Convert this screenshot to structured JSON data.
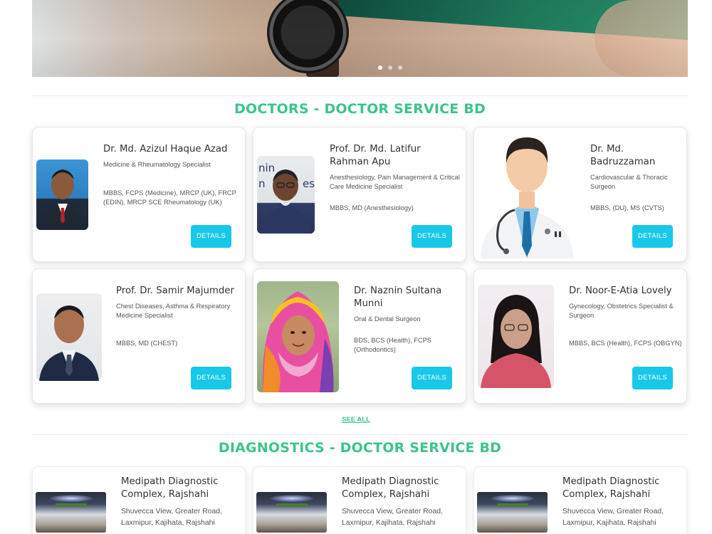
{
  "carousel": {
    "slide_count": 3,
    "active_index": 0
  },
  "doctors_section": {
    "title": "DOCTORS - DOCTOR SERVICE BD",
    "see_all_label": "SEE ALL"
  },
  "doctors": [
    {
      "name": "Dr. Md. Azizul Haque Azad",
      "specialty": "Medicine & Rheumatology Specialist",
      "degrees": "MBBS, FCPS (Medicine), MRCP (UK), FRCP (EDIN), MRCP SCE Rheumatology (UK)",
      "details_label": "DETAILS"
    },
    {
      "name": "Prof. Dr. Md. Latifur Rahman Apu",
      "specialty": "Anesthesiology, Pain Management & Critical Care Medicine Specialist",
      "degrees": "MBBS, MD (Anesthesiology)",
      "details_label": "DETAILS"
    },
    {
      "name": "Dr. Md. Badruzzaman",
      "specialty": "Cardiovascular & Thoracic Surgeon",
      "degrees": "MBBS, (DU), MS (CVTS)",
      "details_label": "DETAILS"
    },
    {
      "name": "Prof. Dr. Samir Majumder",
      "specialty": "Chest Diseases, Asthma & Respiratory Medicine Specialist",
      "degrees": "MBBS, MD (CHEST)",
      "details_label": "DETAILS"
    },
    {
      "name": "Dr. Naznin Sultana Munni",
      "specialty": "Oral & Dental Surgeon",
      "degrees": "BDS, BCS (Health), FCPS (Orthodontics)",
      "details_label": "DETAILS"
    },
    {
      "name": "Dr. Noor-E-Atia Lovely",
      "specialty": "Gynecology, Obstetrics Specialist & Surgeon",
      "degrees": "MBBS, BCS (Health), FCPS (OBGYN)",
      "details_label": "DETAILS"
    }
  ],
  "diagnostics_section": {
    "title": "DIAGNOSTICS - DOCTOR SERVICE BD"
  },
  "diagnostics": [
    {
      "name": "Medipath Diagnostic Complex, Rajshahi",
      "address": "Shuvecca View, Greater Road, Laxmipur, Kajihata, Rajshahi"
    },
    {
      "name": "Medipath Diagnostic Complex, Rajshahi",
      "address": "Shuvecca View, Greater Road, Laxmipur, Kajihata, Rajshahi"
    },
    {
      "name": "Medipath Diagnostic Complex, Rajshahi",
      "address": "Shuvecca View, Greater Road, Laxmipur, Kajihata, Rajshahi"
    }
  ],
  "colors": {
    "accent_green": "#3cc48a",
    "button_cyan": "#17c8e8"
  }
}
